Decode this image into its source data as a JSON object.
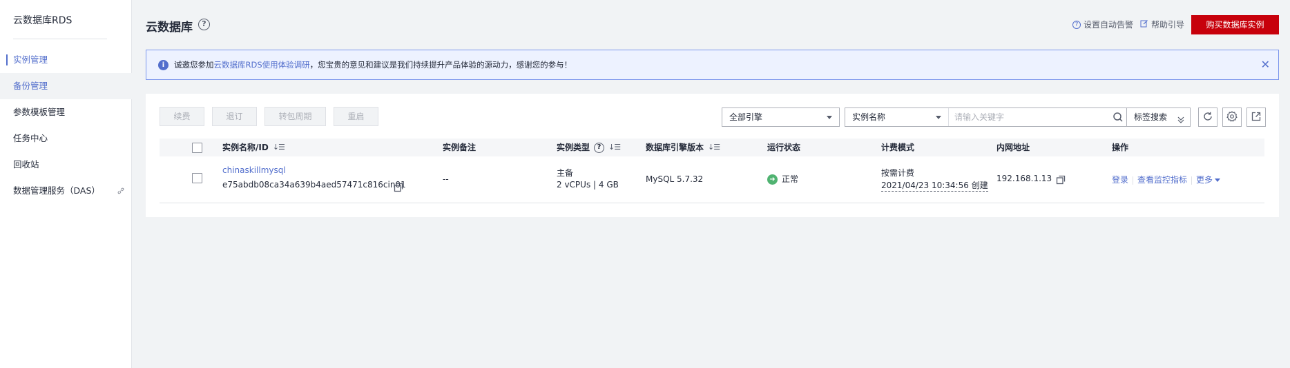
{
  "sidebar": {
    "title": "云数据库RDS",
    "items": [
      {
        "label": "实例管理"
      },
      {
        "label": "备份管理"
      },
      {
        "label": "参数模板管理"
      },
      {
        "label": "任务中心"
      },
      {
        "label": "回收站"
      },
      {
        "label": "数据管理服务（DAS）"
      }
    ]
  },
  "header": {
    "title": "云数据库",
    "help_glyph": "?",
    "alarm_link": "设置自动告警",
    "guide_link": "帮助引导",
    "buy_button": "购买数据库实例"
  },
  "notice": {
    "prefix": "诚邀您参加",
    "link": "云数据库RDS使用体验调研",
    "suffix": "，您宝贵的意见和建议是我们持续提升产品体验的源动力，感谢您的参与！",
    "close": "✕"
  },
  "toolbar": {
    "renew": "续费",
    "unsubscribe": "退订",
    "to_monthly": "转包周期",
    "restart": "重启",
    "engine_select": "全部引擎",
    "search_field": "实例名称",
    "search_placeholder": "请输入关键字",
    "tag_search": "标签搜索"
  },
  "table": {
    "headers": {
      "name_id": "实例名称/ID",
      "remark": "实例备注",
      "type": "实例类型",
      "engine_version": "数据库引擎版本",
      "status": "运行状态",
      "billing": "计费模式",
      "private_ip": "内网地址",
      "actions": "操作"
    },
    "rows": [
      {
        "name": "chinaskillmysql",
        "id": "e75abdb08ca34a639b4aed57471c816cin01",
        "remark": "--",
        "type_role": "主备",
        "type_spec": "2 vCPUs | 4 GB",
        "engine_version": "MySQL 5.7.32",
        "status": "正常",
        "billing_mode": "按需计费",
        "billing_created": "2021/04/23 10:34:56 创建",
        "private_ip": "192.168.1.13",
        "action_login": "登录",
        "action_monitor": "查看监控指标",
        "action_more": "更多"
      }
    ]
  },
  "colors": {
    "accent": "#526ecc",
    "buy_button": "#c7000b",
    "status_ok": "#50b371"
  }
}
